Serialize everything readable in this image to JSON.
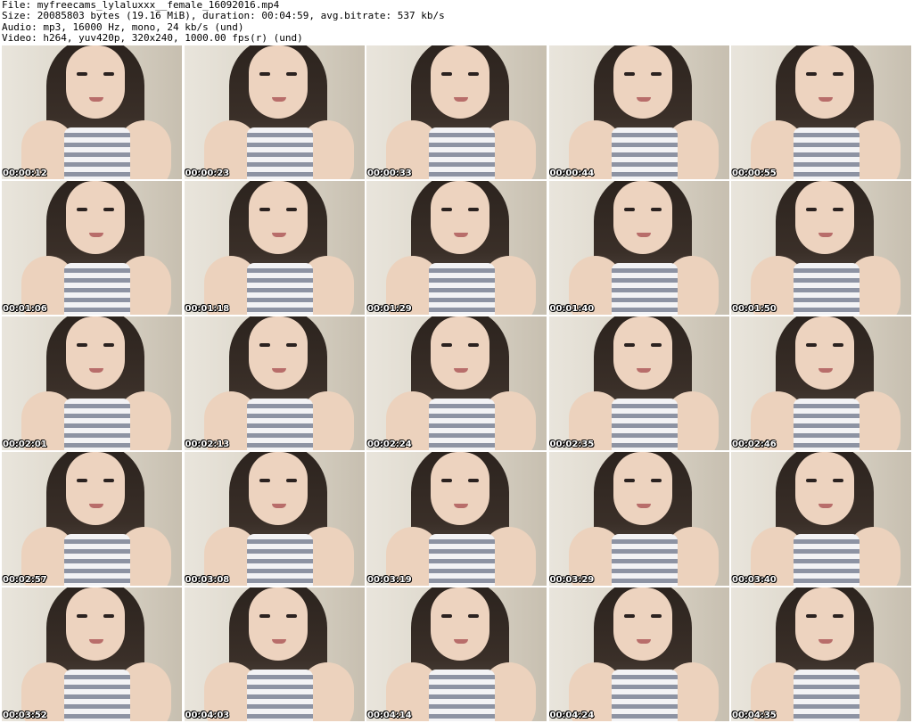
{
  "header": {
    "file_line": "File: myfreecams_lylaluxxx__female_16092016.mp4",
    "size_line": "Size: 20085803 bytes (19.16 MiB), duration: 00:04:59, avg.bitrate: 537 kb/s",
    "audio_line": "Audio: mp3, 16000 Hz, mono, 24 kb/s (und)",
    "video_line": "Video: h264, yuv420p, 320x240, 1000.00 fps(r) (und)"
  },
  "thumbnails": [
    {
      "timestamp": "00:00:12"
    },
    {
      "timestamp": "00:00:23"
    },
    {
      "timestamp": "00:00:33"
    },
    {
      "timestamp": "00:00:44"
    },
    {
      "timestamp": "00:00:55"
    },
    {
      "timestamp": "00:01:06"
    },
    {
      "timestamp": "00:01:18"
    },
    {
      "timestamp": "00:01:29"
    },
    {
      "timestamp": "00:01:40"
    },
    {
      "timestamp": "00:01:50"
    },
    {
      "timestamp": "00:02:01"
    },
    {
      "timestamp": "00:02:13"
    },
    {
      "timestamp": "00:02:24"
    },
    {
      "timestamp": "00:02:35"
    },
    {
      "timestamp": "00:02:46"
    },
    {
      "timestamp": "00:02:57"
    },
    {
      "timestamp": "00:03:08"
    },
    {
      "timestamp": "00:03:19"
    },
    {
      "timestamp": "00:03:29"
    },
    {
      "timestamp": "00:03:40"
    },
    {
      "timestamp": "00:03:52"
    },
    {
      "timestamp": "00:04:03"
    },
    {
      "timestamp": "00:04:14"
    },
    {
      "timestamp": "00:04:24"
    },
    {
      "timestamp": "00:04:35"
    }
  ]
}
